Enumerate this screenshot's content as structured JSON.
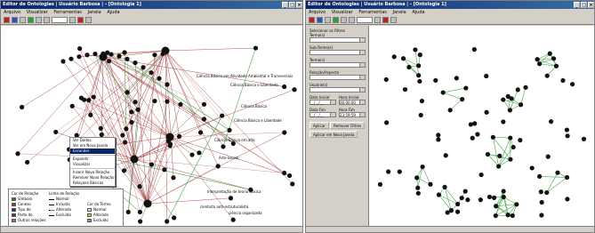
{
  "left_window": {
    "title": "Editor de Ontologias | Usuário Barbosa | - [Ontologia 1]",
    "menu": [
      "Arquivo",
      "Visualizar",
      "Ferramentas",
      "Janela",
      "Ajuda"
    ]
  },
  "right_window": {
    "title": "Editor de Ontologias | Usuário Barbosa | - [Ontologia 1]",
    "menu": [
      "Arquivo",
      "Visualizar",
      "Ferramentas",
      "Janela",
      "Ajuda"
    ]
  },
  "window_controls": [
    "_",
    "□",
    "×"
  ],
  "graph_labels": [
    "Ciência Básica em Atividade Ambiental e Transversais",
    "Ciência Básica e Liberdade",
    "Ciência Básica",
    "Ciência Básica e Liberdade",
    "Ciência Básica em alta",
    "Arte escola",
    "Interpretação de teoria básica",
    "cientista anti-estruturalista",
    "ciência organizada"
  ],
  "context_menu": [
    "Ver Dados",
    "Ver em Nova Janela",
    "Esconder",
    "",
    "Expandir",
    "Visualizar",
    "",
    "Inserir Nova Relação",
    "Remover Nova Relação",
    "Relações Básicas"
  ],
  "context_menu_highlight": "Esconder",
  "legend": {
    "nodes_title": "Cor de Relação",
    "nodes": [
      {
        "label": "Símbolo",
        "color": "#2a8a2a"
      },
      {
        "label": "Conexo",
        "color": "#c02020"
      },
      {
        "label": "Tipo de",
        "color": "#2030a0"
      },
      {
        "label": "Parte de",
        "color": "#8a2020"
      },
      {
        "label": "Outras relações",
        "color": "#808080"
      }
    ],
    "lines_title": "Linha de Relação",
    "lines": [
      "Normal",
      "Incluída",
      "Alterada",
      "Excluída"
    ],
    "cursor_title": "Cor do Termo",
    "cursor": [
      {
        "label": "Normal",
        "color": "#e0e0e0"
      },
      {
        "label": "Alterado",
        "color": "#e0c040"
      },
      {
        "label": "Excluído",
        "color": "#909090"
      }
    ]
  },
  "filter_panel": {
    "title": "Selecionar os Filtros",
    "fields": [
      "Termo(s)",
      "Sub-Termo(s)",
      "Termo(s)",
      "Relação/Aspecto",
      "Usuário(s)"
    ],
    "date_from_label": "Data Inicial",
    "time_from_label": "Hora Inicial",
    "date_from": "__/__/__",
    "time_from": "00:00:00",
    "date_to_label": "Data Fim",
    "time_to_label": "Hora Fim",
    "date_to": "__/__/__",
    "time_to": "23:59:59",
    "apply_label": "Aplicar",
    "remove_label": "Remover Filtros",
    "apply_new_window_label": "Aplicar em Nova Janela"
  },
  "colors": {
    "edge_red": "#9a2a2a",
    "edge_green": "#4aa84a",
    "node": "#111111",
    "selection": "#0a246a"
  }
}
